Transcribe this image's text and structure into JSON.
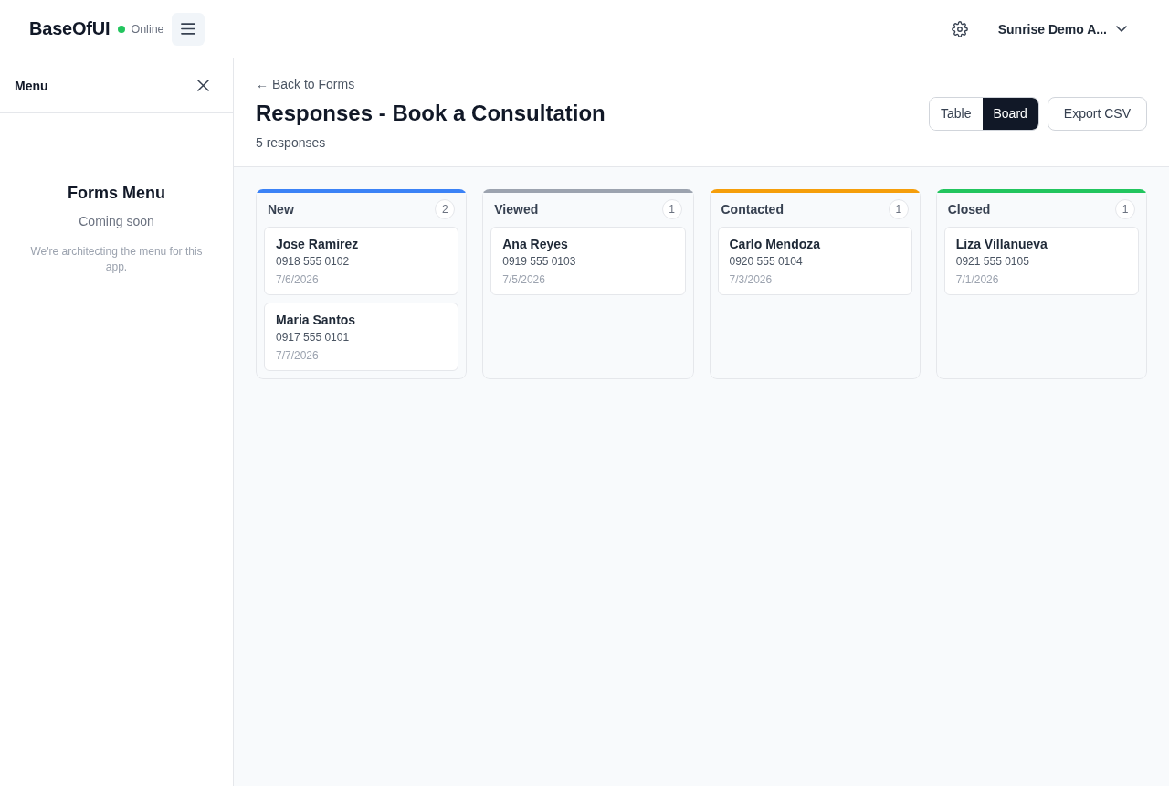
{
  "app": {
    "name": "BaseOfUI",
    "status": "Online",
    "online": true
  },
  "header": {
    "account": "Sunrise Demo A..."
  },
  "sidebar": {
    "title": "Menu",
    "heading": "Forms Menu",
    "subheading": "Coming soon",
    "note": "We're architecting the menu for this app."
  },
  "page": {
    "back_link": "← Back to Forms",
    "title": "Responses - Book a Consultation",
    "count": "5 responses"
  },
  "view_toggle": [
    {
      "label": "Table",
      "selected": false
    },
    {
      "label": "Board",
      "selected": true
    }
  ],
  "export_button": "Export CSV",
  "board": {
    "columns": [
      {
        "title": "New",
        "count": "2",
        "color": "#3b82f6",
        "cards": [
          {
            "name": "Jose Ramirez",
            "phone": "0918 555 0102",
            "date": "7/6/2026"
          },
          {
            "name": "Maria Santos",
            "phone": "0917 555 0101",
            "date": "7/7/2026"
          }
        ]
      },
      {
        "title": "Viewed",
        "count": "1",
        "color": "#9ca3af",
        "cards": [
          {
            "name": "Ana Reyes",
            "phone": "0919 555 0103",
            "date": "7/5/2026"
          }
        ]
      },
      {
        "title": "Contacted",
        "count": "1",
        "color": "#f59e0b",
        "cards": [
          {
            "name": "Carlo Mendoza",
            "phone": "0920 555 0104",
            "date": "7/3/2026"
          }
        ]
      },
      {
        "title": "Closed",
        "count": "1",
        "color": "#22c55e",
        "cards": [
          {
            "name": "Liza Villanueva",
            "phone": "0921 555 0105",
            "date": "7/1/2026"
          }
        ]
      }
    ]
  }
}
